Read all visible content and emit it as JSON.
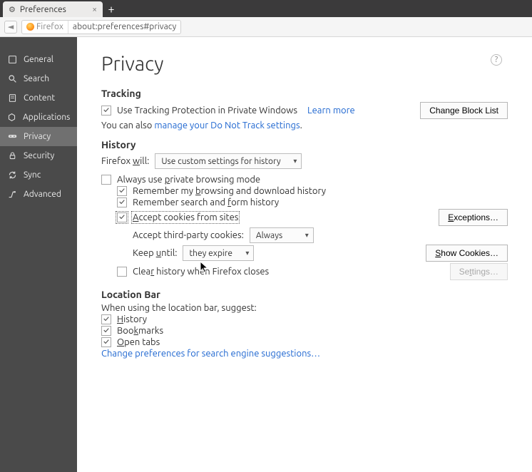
{
  "tab": {
    "title": "Preferences"
  },
  "url": {
    "badge": "Firefox",
    "value": "about:preferences#privacy"
  },
  "sidebar": {
    "items": [
      {
        "label": "General"
      },
      {
        "label": "Search"
      },
      {
        "label": "Content"
      },
      {
        "label": "Applications"
      },
      {
        "label": "Privacy"
      },
      {
        "label": "Security"
      },
      {
        "label": "Sync"
      },
      {
        "label": "Advanced"
      }
    ]
  },
  "page": {
    "title": "Privacy"
  },
  "tracking": {
    "heading": "Tracking",
    "checkbox_label": "Use Tracking Protection in Private Windows",
    "learn_more": "Learn more",
    "change_block_list": "Change Block List",
    "dnt_prefix": "You can also ",
    "dnt_link": "manage your Do Not Track settings",
    "dnt_suffix": "."
  },
  "history": {
    "heading": "History",
    "firefox_will_pre": "Firefox ",
    "firefox_will_u": "w",
    "firefox_will_post": "ill:",
    "mode_value": "Use custom settings for history",
    "always_private_pre": "Always use ",
    "always_private_u": "p",
    "always_private_post": "rivate browsing mode",
    "remember_history_pre": "Remember my ",
    "remember_history_u": "b",
    "remember_history_post": "rowsing and download history",
    "remember_search_pre": "Remember search and ",
    "remember_search_u": "f",
    "remember_search_post": "orm history",
    "accept_cookies_u": "A",
    "accept_cookies_post": "ccept cookies from sites",
    "exceptions_u": "E",
    "exceptions_post": "xceptions…",
    "third_party_label": "Accept third-party cookies:",
    "third_party_value": "Always",
    "keep_until_pre": "Keep ",
    "keep_until_u": "u",
    "keep_until_post": "ntil:",
    "keep_until_value": "they expire",
    "show_cookies_u": "S",
    "show_cookies_post": "how Cookies…",
    "clear_on_close_pre": "Clea",
    "clear_on_close_u": "r",
    "clear_on_close_post": " history when Firefox closes",
    "settings_pre": "Se",
    "settings_u": "t",
    "settings_post": "tings…"
  },
  "location_bar": {
    "heading": "Location Bar",
    "intro": "When using the location bar, suggest:",
    "history_u": "H",
    "history_post": "istory",
    "bookmarks_pre": "Boo",
    "bookmarks_u": "k",
    "bookmarks_post": "marks",
    "open_tabs_u": "O",
    "open_tabs_post": "pen tabs",
    "change_prefs": "Change preferences for search engine suggestions…"
  }
}
